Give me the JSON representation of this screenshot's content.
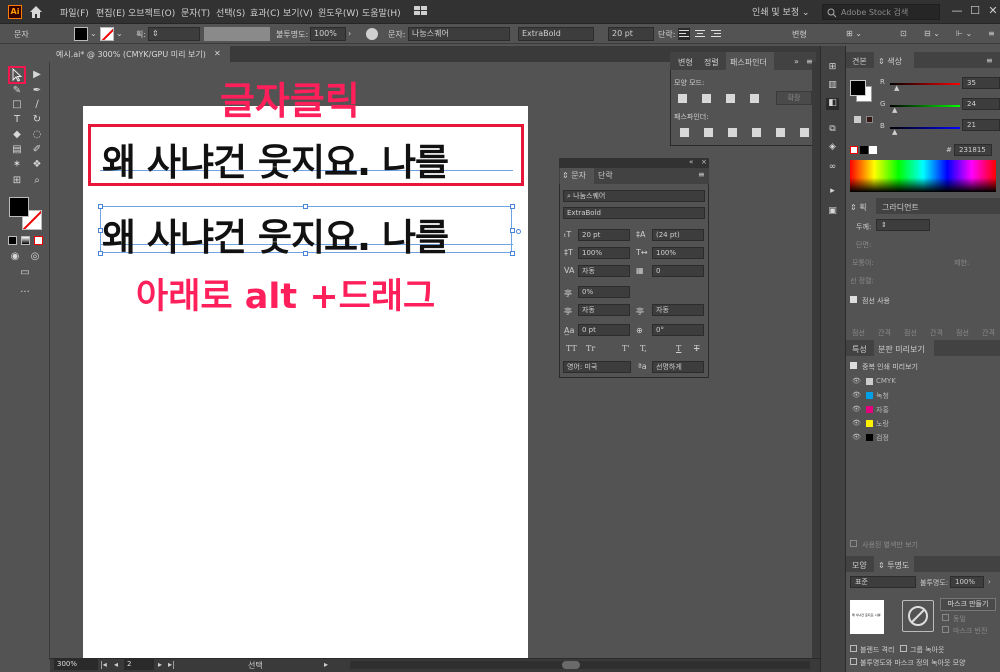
{
  "menubar": {
    "logo": "Ai",
    "items": [
      "파일(F)",
      "편집(E)",
      "오브젝트(O)",
      "문자(T)",
      "선택(S)",
      "효과(C)",
      "보기(V)",
      "윈도우(W)",
      "도움말(H)"
    ],
    "workspace": "인쇄 및 보정 ⌄",
    "stock_search_placeholder": "Adobe Stock 검색",
    "window_controls": [
      "—",
      "☐",
      "✕"
    ]
  },
  "control_bar": {
    "label": "문자",
    "stroke_label": "획:",
    "opacity_label": "불투명도:",
    "opacity_value": "100%",
    "char_label": "문자:",
    "font_name": "나눔스퀘어",
    "font_weight": "ExtraBold",
    "font_size": "20 pt",
    "paragraph_label": "단락:",
    "transform_label": "변형"
  },
  "document_tab": {
    "title": "예시.ai* @ 300% (CMYK/GPU 미리 보기)",
    "close": "✕"
  },
  "canvas": {
    "text_line_1": "왜 사냐건 웃지요. 나를",
    "text_line_2": "왜 사냐건 웃지요. 나를",
    "annotation_click": "글자클릭",
    "annotation_drag": "아래로 alt +드래그"
  },
  "character_panel": {
    "tabs": [
      "문자",
      "단락"
    ],
    "font_name": "나눔스퀘어",
    "font_style": "ExtraBold",
    "font_size": "20 pt",
    "leading": "(24 pt)",
    "vertical_scale": "100%",
    "horizontal_scale": "100%",
    "kerning": "자동",
    "tracking": "0",
    "tsume": "0%",
    "aki_left": "자동",
    "aki_right": "자동",
    "baseline_shift": "0 pt",
    "rotation": "0°",
    "text_styles": [
      "TT",
      "Tr",
      "T'",
      "T,",
      "T",
      "T"
    ],
    "language": "영어: 미국",
    "anti_alias": "선명하게"
  },
  "pathfinder_panel": {
    "tabs": [
      "변형",
      "정렬",
      "패스파인더"
    ],
    "shape_modes_label": "모양 모드:",
    "pathfinders_label": "패스파인더:",
    "expand_label": "확장"
  },
  "color_panel": {
    "tabs": [
      "견본",
      "색상"
    ],
    "r_label": "R",
    "g_label": "G",
    "b_label": "B",
    "r_value": "35",
    "g_value": "24",
    "b_value": "21",
    "hex": "231815",
    "hex_prefix": "#"
  },
  "stroke_panel": {
    "tabs": [
      "획",
      "그라디언트"
    ],
    "weight_label": "두께:",
    "cap_label": "단면:",
    "corner_label": "모퉁이:",
    "limit_label": "제한:",
    "align_label": "선 정렬:",
    "dash_label": "점선 사용",
    "dash_cols": [
      "점선",
      "간격",
      "점선",
      "간격",
      "점선",
      "간격"
    ]
  },
  "separations_panel": {
    "tabs": [
      "특성",
      "분판 미리보기"
    ],
    "overprint_label": "중복 인쇄 미리보기",
    "plates": [
      {
        "name": "CMYK",
        "color": "#cccccc"
      },
      {
        "name": "녹청",
        "color": "#00a0e9"
      },
      {
        "name": "자홍",
        "color": "#e4007f"
      },
      {
        "name": "노랑",
        "color": "#fff100"
      },
      {
        "name": "검정",
        "color": "#000000"
      }
    ],
    "spot_label": "사용된 별색만 보기"
  },
  "transparency_panel": {
    "tabs": [
      "모양",
      "투명도"
    ],
    "blend_mode": "표준",
    "opacity_label": "불투명도:",
    "opacity_value": "100%",
    "make_mask": "마스크 만들기",
    "clip_label": "동일",
    "invert_label": "마스크 반전",
    "isolate_label": "블렌드 격리",
    "knockout_label": "그룹 녹아웃",
    "define_label": "불투명도와 마스크 정의 녹아웃 모양",
    "thumb_text": "왜 사냐건 웃지요. 나를"
  },
  "status_bar": {
    "zoom": "300%",
    "page": "2",
    "mode": "선택"
  }
}
